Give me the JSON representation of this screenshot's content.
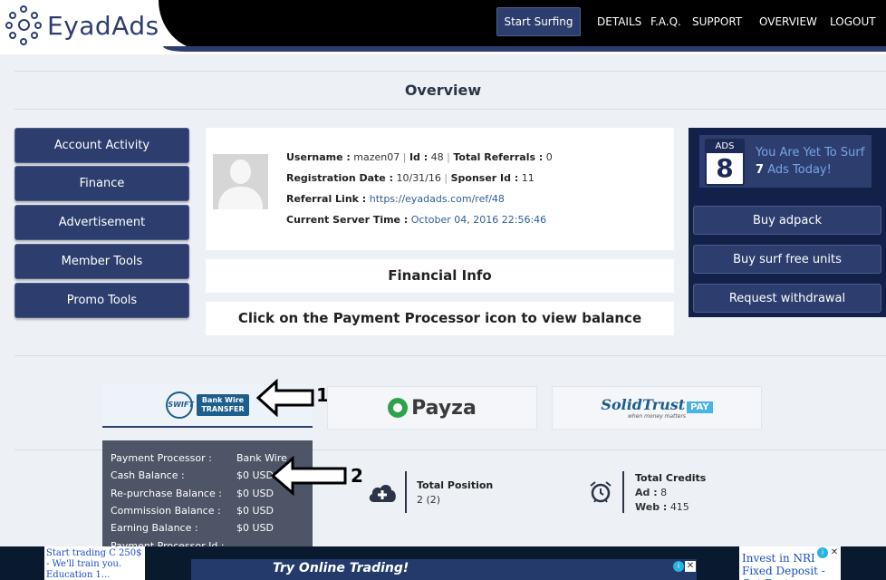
{
  "header": {
    "logo_text": "EyadAds",
    "start_surfing": "Start Surfing",
    "nav": [
      "DETAILS",
      "F.A.Q.",
      "SUPPORT",
      "OVERVIEW",
      "LOGOUT"
    ]
  },
  "page_title": "Overview",
  "menu": [
    "Account Activity",
    "Finance",
    "Advertisement",
    "Member Tools",
    "Promo Tools"
  ],
  "profile": {
    "username_label": "Username :",
    "username": "mazen07",
    "id_label": "Id :",
    "id": "48",
    "referrals_label": "Total Referrals :",
    "referrals": "0",
    "reg_label": "Registration Date :",
    "reg_date": "10/31/16",
    "sponsor_label": "Sponser Id :",
    "sponsor_id": "11",
    "ref_label": "Referral Link :",
    "ref_link": "https://eyadads.com/ref/48",
    "time_label": "Current Server Time :",
    "server_time": "October 04, 2016 22:56:46"
  },
  "financial": {
    "title": "Financial Info",
    "hint": "Click on the Payment Processor icon to view balance"
  },
  "ads_card": {
    "icon_label": "ADS",
    "icon_number": "8",
    "text_before": "You Are Yet To Surf",
    "count": "7",
    "text_after": "Ads Today!"
  },
  "right_buttons": [
    "Buy adpack",
    "Buy surf free units",
    "Request withdrawal"
  ],
  "processors": {
    "swift": {
      "globe": "SWIFT",
      "tag_line1": "Bank Wire",
      "tag_line2": "TRANSFER"
    },
    "payza": {
      "name": "Payza"
    },
    "solidtrust": {
      "name": "SolidTrust",
      "pay": "PAY",
      "tagline": "when money matters"
    }
  },
  "annotations": {
    "arrow1": "1",
    "arrow2": "2"
  },
  "stats": {
    "position": {
      "title": "Total Position",
      "value": "2 (2)"
    },
    "credits": {
      "title": "Total Credits",
      "ad_label": "Ad :",
      "ad_value": "8",
      "web_label": "Web :",
      "web_value": "415"
    }
  },
  "tooltip": {
    "rows": [
      {
        "k": "Payment Processor :",
        "v": "Bank Wire"
      },
      {
        "k": "Cash Balance :",
        "v": "$0 USD"
      },
      {
        "k": "Re-purchase Balance :",
        "v": "$0 USD"
      },
      {
        "k": "Commission Balance :",
        "v": "$0 USD"
      },
      {
        "k": "Earning Balance :",
        "v": "$0 USD"
      },
      {
        "k": "Payment Processor Id :",
        "v": ""
      }
    ]
  },
  "ads": {
    "left": "Start trading C 250$ - We'll train you. Education 1...",
    "center": "Try Online Trading!",
    "right": "Invest in NRI Fixed Deposit - Get Best"
  },
  "colors": {
    "primary": "#2d3e6e",
    "dark": "#12204a",
    "accent_text": "#74a5e6"
  }
}
